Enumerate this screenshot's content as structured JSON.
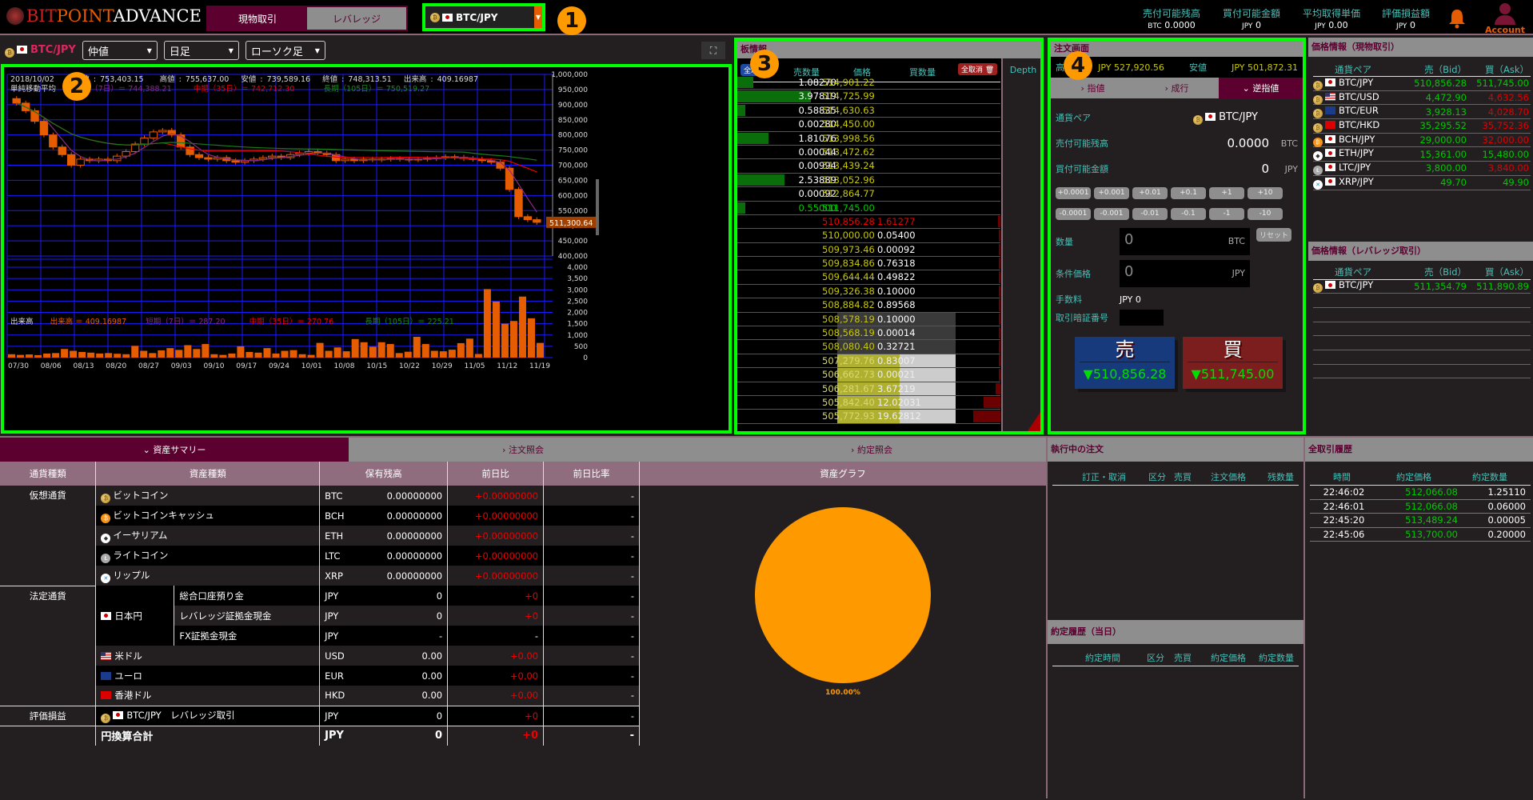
{
  "header": {
    "logo": {
      "bit": "BIT",
      "point": "POINT",
      "advance": "ADVANCE"
    },
    "mode_tabs": [
      "現物取引",
      "レバレッジ"
    ],
    "pair": "BTC/JPY",
    "stats": [
      {
        "label": "売付可能残高",
        "unit": "BTC",
        "value": "0.0000"
      },
      {
        "label": "買付可能金額",
        "unit": "JPY",
        "value": "0"
      },
      {
        "label": "平均取得単価",
        "unit": "JPY",
        "value": "0.00"
      },
      {
        "label": "評価損益額",
        "unit": "JPY",
        "value": "0"
      }
    ],
    "account": "Account"
  },
  "annotations": [
    "1",
    "2",
    "3",
    "4"
  ],
  "chart_tools": {
    "pair": "BTC/JPY",
    "price_type": "仲値",
    "period": "日足",
    "style": "ローソク足"
  },
  "chart": {
    "info_line": {
      "date": "2018/10/02",
      "open_label": "始値",
      "open": "753,403.15",
      "high_label": "高値",
      "high": "755,637.00",
      "low_label": "安値",
      "low": "739,589.16",
      "close_label": "終値",
      "close": "748,313.51",
      "vol_label": "出来高",
      "vol": "409.16987"
    },
    "ma_line": {
      "label": "単純移動平均",
      "short": "短期（7日）＝ 744,388.21",
      "mid": "中期（35日）＝ 742,712.30",
      "long": "長期（105日）＝ 750,519.27"
    },
    "vol_line": {
      "label": "出来高",
      "vol": "出来高 ＝ 409.16987",
      "short": "短期（7日）＝ 287.20",
      "mid": "中期（35日）＝ 270.76",
      "long": "長期（105日）＝ 225.21"
    },
    "last_price": "511,300.64",
    "price_ticks": [
      "1,000,000",
      "950,000",
      "900,000",
      "850,000",
      "800,000",
      "750,000",
      "700,000",
      "650,000",
      "600,000",
      "550,000",
      "500,000",
      "450,000",
      "400,000"
    ],
    "volume_ticks": [
      "4,000",
      "3,500",
      "3,000",
      "2,500",
      "2,000",
      "1,500",
      "1,000",
      "500",
      "0"
    ],
    "date_ticks": [
      "07/30",
      "08/06",
      "08/13",
      "08/20",
      "08/27",
      "09/03",
      "09/10",
      "09/17",
      "09/24",
      "10/01",
      "10/08",
      "10/15",
      "10/22",
      "10/29",
      "11/05",
      "11/12",
      "11/19"
    ]
  },
  "chart_data": {
    "type": "candlestick",
    "price_range": [
      400000,
      1000000
    ],
    "volume_range": [
      0,
      4000
    ],
    "closes": [
      905000,
      880000,
      845000,
      800000,
      760000,
      735000,
      700000,
      720000,
      715000,
      720000,
      715000,
      730000,
      745000,
      770000,
      790000,
      810000,
      815000,
      800000,
      760000,
      735000,
      725000,
      720000,
      725000,
      715000,
      710000,
      715000,
      720000,
      725000,
      730000,
      725000,
      735000,
      740000,
      745000,
      740000,
      735000,
      715000,
      720000,
      715000,
      720000,
      718000,
      720000,
      722000,
      720000,
      718000,
      720000,
      722000,
      725000,
      728000,
      726000,
      722000,
      720000,
      715000,
      710000,
      690000,
      620000,
      530000,
      520000,
      511300
    ],
    "volumes": [
      150,
      120,
      140,
      110,
      180,
      200,
      380,
      300,
      250,
      220,
      180,
      200,
      170,
      150,
      520,
      300,
      200,
      320,
      420,
      340,
      550,
      380,
      600,
      150,
      120,
      180,
      500,
      250,
      220,
      420,
      180,
      300,
      330,
      150,
      120,
      650,
      300,
      450,
      280,
      820,
      680,
      480,
      680,
      600,
      200,
      260,
      920,
      600,
      300,
      280,
      350,
      640,
      840,
      160,
      3030,
      2480,
      1500,
      1620,
      2700,
      1740,
      650
    ]
  },
  "book": {
    "title": "板情報",
    "cancel_all_sell": "全取消",
    "cols": [
      "売数量",
      "価格",
      "買数量"
    ],
    "cancel_all_buy": "全取消",
    "depth": "Depth",
    "asks": [
      {
        "qty": "1.08270",
        "price": "514,901.22",
        "bar": 0.06
      },
      {
        "qty": "3.97819",
        "price": "514,725.99",
        "bar": 0.28
      },
      {
        "qty": "0.58835",
        "price": "514,630.63",
        "bar": 0.03
      },
      {
        "qty": "0.00280",
        "price": "514,450.00",
        "bar": 0
      },
      {
        "qty": "1.81076",
        "price": "513,998.56",
        "bar": 0.12
      },
      {
        "qty": "0.00044",
        "price": "513,472.62",
        "bar": 0
      },
      {
        "qty": "0.00994",
        "price": "513,439.24",
        "bar": 0
      },
      {
        "qty": "2.53889",
        "price": "513,052.96",
        "bar": 0.18
      },
      {
        "qty": "0.00092",
        "price": "512,864.77",
        "bar": 0
      },
      {
        "qty": "0.55000",
        "price": "511,745.00",
        "bar": 0.03
      }
    ],
    "bids": [
      {
        "price": "510,856.28",
        "qty": "1.61277"
      },
      {
        "price": "510,000.00",
        "qty": "0.05400"
      },
      {
        "price": "509,973.46",
        "qty": "0.00092"
      },
      {
        "price": "509,834.86",
        "qty": "0.76318"
      },
      {
        "price": "509,644.44",
        "qty": "0.49822"
      },
      {
        "price": "509,326.38",
        "qty": "0.10000"
      },
      {
        "price": "508,884.82",
        "qty": "0.89568"
      },
      {
        "price": "508,578.19",
        "qty": "0.10000"
      },
      {
        "price": "508,568.19",
        "qty": "0.00014"
      },
      {
        "price": "508,080.40",
        "qty": "0.32721"
      },
      {
        "price": "507,279.76",
        "qty": "0.83007"
      },
      {
        "price": "506,662.73",
        "qty": "0.00021"
      },
      {
        "price": "506,281.67",
        "qty": "3.67219"
      },
      {
        "price": "505,842.40",
        "qty": "12.02031"
      },
      {
        "price": "505,772.93",
        "qty": "19.62812"
      }
    ]
  },
  "order": {
    "title": "注文画面",
    "high_label": "高値",
    "high": "JPY 527,920.56",
    "low_label": "安値",
    "low": "JPY 501,872.31",
    "tabs": [
      "指値",
      "成行",
      "逆指値"
    ],
    "pair_label": "通貨ペア",
    "pair": "BTC/JPY",
    "sellable_label": "売付可能残高",
    "sellable": "0.0000",
    "sellable_unit": "BTC",
    "buyable_label": "買付可能金額",
    "buyable": "0",
    "buyable_unit": "JPY",
    "plus": [
      "+0.0001",
      "+0.001",
      "+0.01",
      "+0.1",
      "+1",
      "+10"
    ],
    "minus": [
      "-0.0001",
      "-0.001",
      "-0.01",
      "-0.1",
      "-1",
      "-10"
    ],
    "qty_label": "数量",
    "qty_value": "0",
    "qty_unit": "BTC",
    "reset": "リセット",
    "cond_label": "条件価格",
    "cond_value": "0",
    "cond_unit": "JPY",
    "fee_label": "手数料",
    "fee": "JPY 0",
    "pin_label": "取引暗証番号",
    "sell": {
      "label": "売",
      "price": "510,856.28"
    },
    "buy": {
      "label": "買",
      "price": "511,745.00"
    }
  },
  "prices": {
    "spot_title": "価格情報（現物取引）",
    "cols": [
      "通貨ペア",
      "売（Bid）",
      "買（Ask）"
    ],
    "spot": [
      {
        "coin": "btc",
        "flag": "jp",
        "pair": "BTC/JPY",
        "bid": "510,856.28",
        "ask": "511,745.00",
        "ask_color": "#00c800"
      },
      {
        "coin": "btc",
        "flag": "us",
        "pair": "BTC/USD",
        "bid": "4,472.90",
        "ask": "4,632.56",
        "ask_color": "#e00000"
      },
      {
        "coin": "btc",
        "flag": "eu",
        "pair": "BTC/EUR",
        "bid": "3,928.13",
        "ask": "4,028.70",
        "ask_color": "#e00000"
      },
      {
        "coin": "btc",
        "flag": "hk",
        "pair": "BTC/HKD",
        "bid": "35,295.52",
        "ask": "35,752.36",
        "ask_color": "#e00000"
      },
      {
        "coin": "bch",
        "flag": "jp",
        "pair": "BCH/JPY",
        "bid": "29,000.00",
        "ask": "32,000.00",
        "ask_color": "#e00000"
      },
      {
        "coin": "eth",
        "flag": "jp",
        "pair": "ETH/JPY",
        "bid": "15,361.00",
        "ask": "15,480.00",
        "ask_color": "#00c800"
      },
      {
        "coin": "ltc",
        "flag": "jp",
        "pair": "LTC/JPY",
        "bid": "3,800.00",
        "ask": "3,840.00",
        "ask_color": "#e00000"
      },
      {
        "coin": "xrp",
        "flag": "jp",
        "pair": "XRP/JPY",
        "bid": "49.70",
        "ask": "49.90",
        "ask_color": "#00c800"
      }
    ],
    "lev_title": "価格情報（レバレッジ取引）",
    "lev": [
      {
        "coin": "btc",
        "flag": "jp",
        "pair": "BTC/JPY",
        "bid": "511,354.79",
        "ask": "511,890.89"
      }
    ]
  },
  "bottom": {
    "tabs": [
      "資産サマリー",
      "注文照会",
      "約定照会"
    ],
    "cols": [
      "通貨種類",
      "資産種類",
      "保有残高",
      "前日比",
      "前日比率"
    ],
    "graph_title": "資産グラフ",
    "pie_label": "100.00%",
    "pie_color": "#ff9900",
    "groups": {
      "crypto": "仮想通貨",
      "fiat": "法定通貨",
      "pl": "評価損益"
    },
    "crypto": [
      {
        "icon": "btc",
        "name": "ビットコイン",
        "ccy": "BTC",
        "bal": "0.00000000",
        "chg": "+0.00000000",
        "rate": "-"
      },
      {
        "icon": "bch",
        "name": "ビットコインキャッシュ",
        "ccy": "BCH",
        "bal": "0.00000000",
        "chg": "+0.00000000",
        "rate": "-"
      },
      {
        "icon": "eth",
        "name": "イーサリアム",
        "ccy": "ETH",
        "bal": "0.00000000",
        "chg": "+0.00000000",
        "rate": "-"
      },
      {
        "icon": "ltc",
        "name": "ライトコイン",
        "ccy": "LTC",
        "bal": "0.00000000",
        "chg": "+0.00000000",
        "rate": "-"
      },
      {
        "icon": "xrp",
        "name": "リップル",
        "ccy": "XRP",
        "bal": "0.00000000",
        "chg": "+0.00000000",
        "rate": "-"
      }
    ],
    "jpy_name": "日本円",
    "jpy": [
      {
        "name": "総合口座預り金",
        "ccy": "JPY",
        "bal": "0",
        "chg": "+0",
        "rate": "-"
      },
      {
        "name": "レバレッジ証拠金現金",
        "ccy": "JPY",
        "bal": "0",
        "chg": "+0",
        "rate": "-"
      },
      {
        "name": "FX証拠金現金",
        "ccy": "JPY",
        "bal": "-",
        "chg": "-",
        "rate": "-"
      }
    ],
    "fiat": [
      {
        "flag": "us",
        "name": "米ドル",
        "ccy": "USD",
        "bal": "0.00",
        "chg": "+0.00",
        "rate": "-"
      },
      {
        "flag": "eu",
        "name": "ユーロ",
        "ccy": "EUR",
        "bal": "0.00",
        "chg": "+0.00",
        "rate": "-"
      },
      {
        "flag": "hk",
        "name": "香港ドル",
        "ccy": "HKD",
        "bal": "0.00",
        "chg": "+0.00",
        "rate": "-"
      }
    ],
    "pl_row": {
      "name": "BTC/JPY　レバレッジ取引",
      "ccy": "JPY",
      "bal": "0",
      "chg": "+0",
      "rate": "-"
    },
    "total": {
      "name": "円換算合計",
      "ccy": "JPY",
      "bal": "0",
      "chg": "+0",
      "rate": "-"
    }
  },
  "working": {
    "title": "執行中の注文",
    "cols": [
      "訂正・取消",
      "区分",
      "売買",
      "注文価格",
      "残数量"
    ],
    "today_title": "約定履歴（当日）",
    "today_cols": [
      "約定時間",
      "区分",
      "売買",
      "約定価格",
      "約定数量"
    ]
  },
  "history": {
    "title": "全取引履歴",
    "cols": [
      "時間",
      "約定価格",
      "約定数量"
    ],
    "rows": [
      {
        "time": "22:46:02",
        "price": "512,066.08",
        "qty": "1.25110"
      },
      {
        "time": "22:46:01",
        "price": "512,066.08",
        "qty": "0.06000"
      },
      {
        "time": "22:45:20",
        "price": "513,489.24",
        "qty": "0.00005"
      },
      {
        "time": "22:45:06",
        "price": "513,700.00",
        "qty": "0.20000"
      }
    ]
  }
}
